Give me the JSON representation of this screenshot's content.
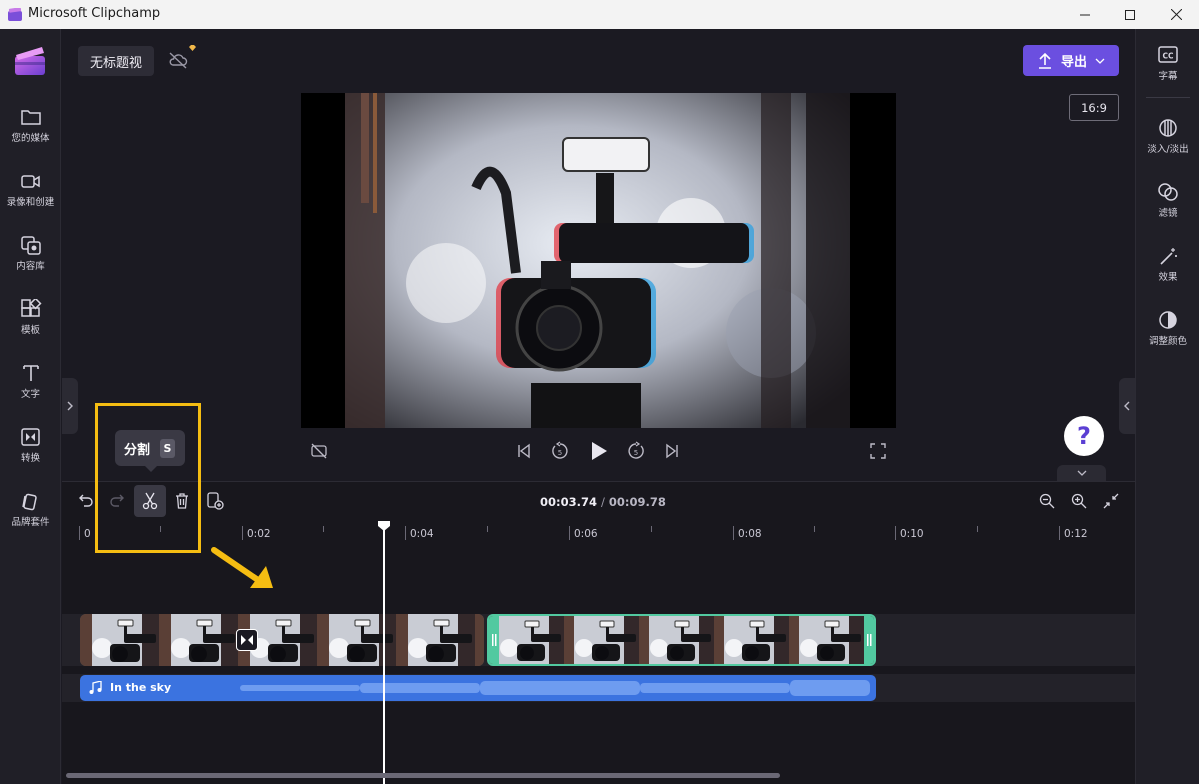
{
  "window": {
    "title": "Microsoft Clipchamp"
  },
  "left_rail": [
    {
      "label": "您的媒体",
      "icon": "folder-icon"
    },
    {
      "label": "录像和创建",
      "icon": "camera-icon"
    },
    {
      "label": "内容库",
      "icon": "content-library-icon"
    },
    {
      "label": "模板",
      "icon": "templates-icon"
    },
    {
      "label": "文字",
      "icon": "text-icon"
    },
    {
      "label": "转换",
      "icon": "transitions-icon"
    },
    {
      "label": "品牌套件",
      "icon": "brand-kit-icon"
    }
  ],
  "right_rail": [
    {
      "label": "字幕",
      "icon": "captions-icon"
    },
    {
      "label": "淡入/淡出",
      "icon": "fade-icon"
    },
    {
      "label": "滤镜",
      "icon": "filters-icon"
    },
    {
      "label": "效果",
      "icon": "effects-icon"
    },
    {
      "label": "调整颜色",
      "icon": "adjust-colors-icon"
    }
  ],
  "project": {
    "name": "无标题视"
  },
  "export": {
    "label": "导出"
  },
  "aspect_ratio": "16:9",
  "help": {
    "label": "?"
  },
  "timeline": {
    "current_time": "00:03.74",
    "separator": "/",
    "total_time": "00:09.78",
    "ticks": [
      "0",
      "0:02",
      "0:04",
      "0:06",
      "0:08",
      "0:10",
      "0:12"
    ]
  },
  "tooltip": {
    "label": "分割",
    "shortcut": "S"
  },
  "audio": {
    "name": "In the sky"
  },
  "colors": {
    "accent": "#6b4fe0",
    "annotation": "#f5bd12",
    "audio_clip": "#3b73e0",
    "selected_clip_border": "#52c9a0"
  }
}
